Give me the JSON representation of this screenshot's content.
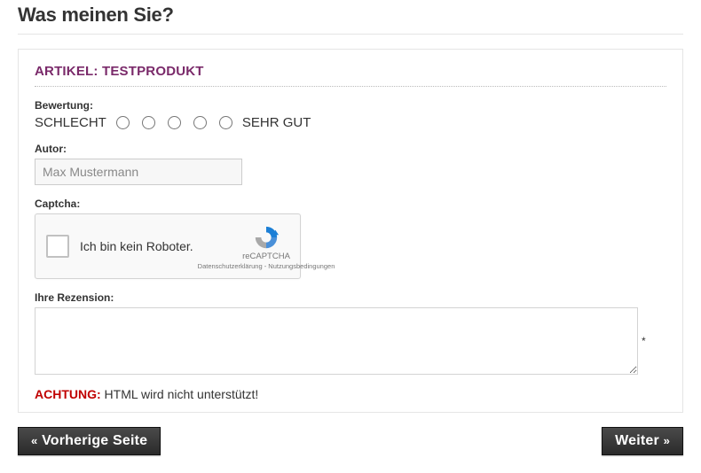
{
  "page": {
    "title": "Was meinen Sie?"
  },
  "article": {
    "heading": "ARTIKEL: TESTPRODUKT"
  },
  "rating": {
    "label": "Bewertung:",
    "low": "SCHLECHT",
    "high": "SEHR GUT"
  },
  "author": {
    "label": "Autor:",
    "value": "Max Mustermann"
  },
  "captcha": {
    "label": "Captcha:",
    "text": "Ich bin kein Roboter.",
    "brand": "reCAPTCHA",
    "privacy": "Datenschutzerklärung",
    "terms": "Nutzungsbedingungen"
  },
  "review": {
    "label": "Ihre Rezension:",
    "value": "",
    "required_mark": "*"
  },
  "warning": {
    "label": "ACHTUNG:",
    "text": " HTML wird nicht unterstützt!"
  },
  "buttons": {
    "prev_arrow": "«",
    "prev": "Vorherige Seite",
    "next": "Weiter",
    "next_arrow": "»"
  }
}
